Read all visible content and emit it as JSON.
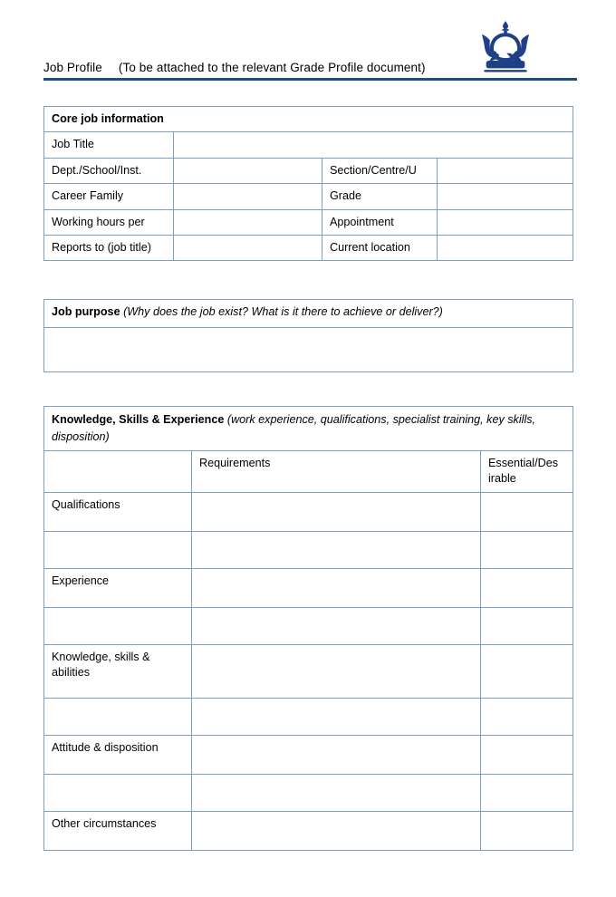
{
  "header": {
    "title": "Job Profile",
    "subtitle": "(To be attached to the relevant Grade Profile document)",
    "logo_name": "queen-mary-crown-logo",
    "rule_color": "#1f4e79"
  },
  "colors": {
    "table_border": "#7f9dc0",
    "header_rule": "#1f4e79",
    "logo": "#1f3f87",
    "page_background": "#ffffff",
    "text": "#000000"
  },
  "core_job_information": {
    "section_title": "Core job information",
    "rows": [
      {
        "label": "Job Title",
        "value": "",
        "label2": "",
        "value2": "",
        "spans": true
      },
      {
        "label": "Dept./School/Inst.",
        "value": "",
        "label2": "Section/Centre/U",
        "value2": "",
        "spans": false
      },
      {
        "label": "Career Family",
        "value": "",
        "label2": "Grade",
        "value2": "",
        "spans": false
      },
      {
        "label": "Working hours per",
        "value": "",
        "label2": "Appointment",
        "value2": "",
        "spans": false
      },
      {
        "label": "Reports to (job title)",
        "value": "",
        "label2": "Current location",
        "value2": "",
        "spans": false
      }
    ]
  },
  "job_purpose": {
    "section_title": "Job purpose",
    "section_hint": "(Why does the job exist? What is it there to achieve or deliver?)",
    "body_value": ""
  },
  "knowledge_skills_experience": {
    "section_title": "Knowledge, Skills & Experience",
    "section_hint": "(work experience, qualifications, specialist training, key skills, disposition)",
    "columns": [
      "",
      "Requirements",
      "Essential/Desirable"
    ],
    "column_essential_display": "Essential/Des irable",
    "rows": [
      {
        "label": "Qualifications",
        "requirements": "",
        "essential_desirable": "",
        "tall": false
      },
      {
        "label": "",
        "requirements": "",
        "essential_desirable": "",
        "tall": false
      },
      {
        "label": "Experience",
        "requirements": "",
        "essential_desirable": "",
        "tall": false
      },
      {
        "label": "",
        "requirements": "",
        "essential_desirable": "",
        "tall": false
      },
      {
        "label": "Knowledge, skills & abilities",
        "requirements": "",
        "essential_desirable": "",
        "tall": true
      },
      {
        "label": "",
        "requirements": "",
        "essential_desirable": "",
        "tall": false
      },
      {
        "label": "Attitude & disposition",
        "requirements": "",
        "essential_desirable": "",
        "tall": false
      },
      {
        "label": "",
        "requirements": "",
        "essential_desirable": "",
        "tall": false
      },
      {
        "label": "Other circumstances",
        "requirements": "",
        "essential_desirable": "",
        "tall": false
      }
    ]
  }
}
